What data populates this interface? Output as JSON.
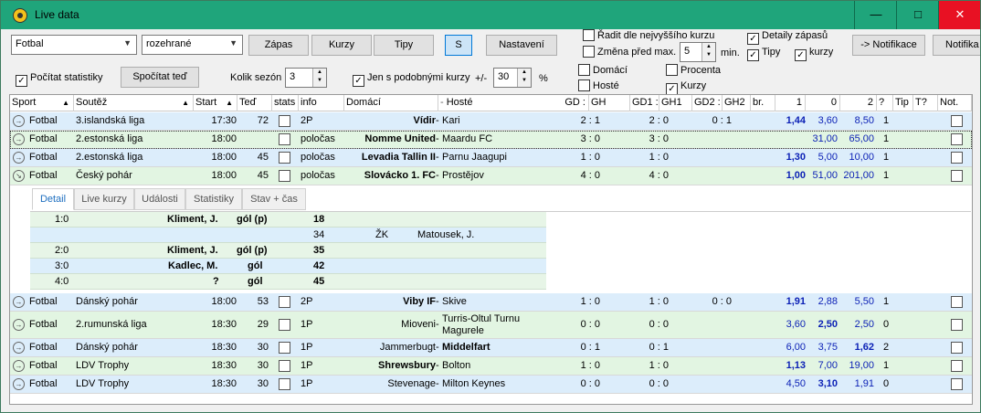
{
  "window": {
    "title": "Live data",
    "min": "—",
    "max": "□",
    "close": "✕"
  },
  "toolbar": {
    "sport": "Fotbal",
    "state": "rozehrané",
    "btn_zapas": "Zápas",
    "btn_kurzy": "Kurzy",
    "btn_tipy": "Tipy",
    "btn_s": "S",
    "btn_nastaveni": "Nastavení",
    "radit": "Řadit dle nejvyššího kurzu",
    "zmena": "Změna před max.",
    "zmena_val": "5",
    "min": "min.",
    "detaily": "Detaily zápasů",
    "tipy": "Tipy",
    "kurzy_chk": "kurzy",
    "notif": "-> Notifikace",
    "notif2": "Notifika",
    "pocitat": "Počítat statistiky",
    "spocitat": "Spočítat teď",
    "kolik": "Kolik sezón",
    "kolik_val": "3",
    "jen": "Jen s podobnými kurzy",
    "pm": "+/-",
    "pm_val": "30",
    "pct": "%",
    "domaci": "Domácí",
    "hoste": "Hosté",
    "procenta": "Procenta",
    "kurzy2": "Kurzy"
  },
  "headers": {
    "sport": "Sport",
    "soutez": "Soutěž",
    "start": "Start",
    "ted": "Teď",
    "stats": "stats",
    "info": "info",
    "domaci": "Domácí",
    "hoste": "Hosté",
    "gd": "GD :",
    "gh": "GH",
    "gd1": "GD1 :",
    "gh1": "GH1",
    "gd2": "GD2 :",
    "gh2": "GH2",
    "br": "br.",
    "o1": "1",
    "o0": "0",
    "o2": "2",
    "q": "?",
    "tip": "Tip",
    "tq": "T?",
    "not": "Not."
  },
  "rows": [
    {
      "sport": "Fotbal",
      "soutez": "3.islandská liga",
      "start": "17:30",
      "ted": "72",
      "info": "2P",
      "home": "Vídir",
      "away": "Kari",
      "gd": "2 : 1",
      "gd1": "2 : 0",
      "gd2": "0 : 1",
      "o1": "1,44",
      "o0": "3,60",
      "o2": "8,50",
      "q": "1"
    },
    {
      "sport": "Fotbal",
      "soutez": "2.estonská liga",
      "start": "18:00",
      "ted": "",
      "info": "poločas",
      "home": "Nomme United",
      "away": "Maardu FC",
      "gd": "3 : 0",
      "gd1": "3 : 0",
      "gd2": "",
      "o1": "",
      "o0": "31,00",
      "o2": "65,00",
      "q": "1"
    },
    {
      "sport": "Fotbal",
      "soutez": "2.estonská liga",
      "start": "18:00",
      "ted": "45",
      "info": "poločas",
      "home": "Levadia Tallin II",
      "away": "Parnu Jaagupi",
      "gd": "1 : 0",
      "gd1": "1 : 0",
      "gd2": "",
      "o1": "1,30",
      "o0": "5,00",
      "o2": "10,00",
      "q": "1"
    },
    {
      "sport": "Fotbal",
      "soutez": "Český pohár",
      "start": "18:00",
      "ted": "45",
      "info": "poločas",
      "home": "Slovácko 1. FC",
      "away": "Prostějov",
      "gd": "4 : 0",
      "gd1": "4 : 0",
      "gd2": "",
      "o1": "1,00",
      "o0": "51,00",
      "o2": "201,00",
      "q": "1"
    },
    {
      "sport": "Fotbal",
      "soutez": "Dánský pohár",
      "start": "18:00",
      "ted": "53",
      "info": "2P",
      "home": "Viby IF",
      "away": "Skive",
      "gd": "1 : 0",
      "gd1": "1 : 0",
      "gd2": "0 : 0",
      "o1": "1,91",
      "o0": "2,88",
      "o2": "5,50",
      "q": "1"
    },
    {
      "sport": "Fotbal",
      "soutez": "2.rumunská liga",
      "start": "18:30",
      "ted": "29",
      "info": "1P",
      "home": "Mioveni",
      "away": "Turris-Oltul Turnu",
      "away2": "Magurele",
      "gd": "0 : 0",
      "gd1": "0 : 0",
      "gd2": "",
      "o1": "3,60",
      "o0": "2,50",
      "o2": "2,50",
      "q": "0"
    },
    {
      "sport": "Fotbal",
      "soutez": "Dánský pohár",
      "start": "18:30",
      "ted": "30",
      "info": "1P",
      "home": "Jammerbugt",
      "away": "Middelfart",
      "gd": "0 : 1",
      "gd1": "0 : 1",
      "gd2": "",
      "o1": "6,00",
      "o0": "3,75",
      "o2": "1,62",
      "q": "2"
    },
    {
      "sport": "Fotbal",
      "soutez": "LDV Trophy",
      "start": "18:30",
      "ted": "30",
      "info": "1P",
      "home": "Shrewsbury",
      "away": "Bolton",
      "gd": "1 : 0",
      "gd1": "1 : 0",
      "gd2": "",
      "o1": "1,13",
      "o0": "7,00",
      "o2": "19,00",
      "q": "1"
    },
    {
      "sport": "Fotbal",
      "soutez": "LDV Trophy",
      "start": "18:30",
      "ted": "30",
      "info": "1P",
      "home": "Stevenage",
      "away": "Milton Keynes",
      "gd": "0 : 0",
      "gd1": "0 : 0",
      "gd2": "",
      "o1": "4,50",
      "o0": "3,10",
      "o2": "1,91",
      "q": "0"
    }
  ],
  "detail_tabs": [
    "Detail",
    "Live kurzy",
    "Události",
    "Statistiky",
    "Stav + čas"
  ],
  "details": [
    {
      "score": "1:0",
      "player": "Kliment, J.",
      "event": "gól (p)",
      "min": "18"
    },
    {
      "min2": "34",
      "event2": "ŽK",
      "player2": "Matousek, J."
    },
    {
      "score": "2:0",
      "player": "Kliment, J.",
      "event": "gól (p)",
      "min": "35"
    },
    {
      "score": "3:0",
      "player": "Kadlec, M.",
      "event": "gól",
      "min": "42"
    },
    {
      "score": "4:0",
      "player": "?",
      "event": "gól",
      "min": "45"
    }
  ]
}
